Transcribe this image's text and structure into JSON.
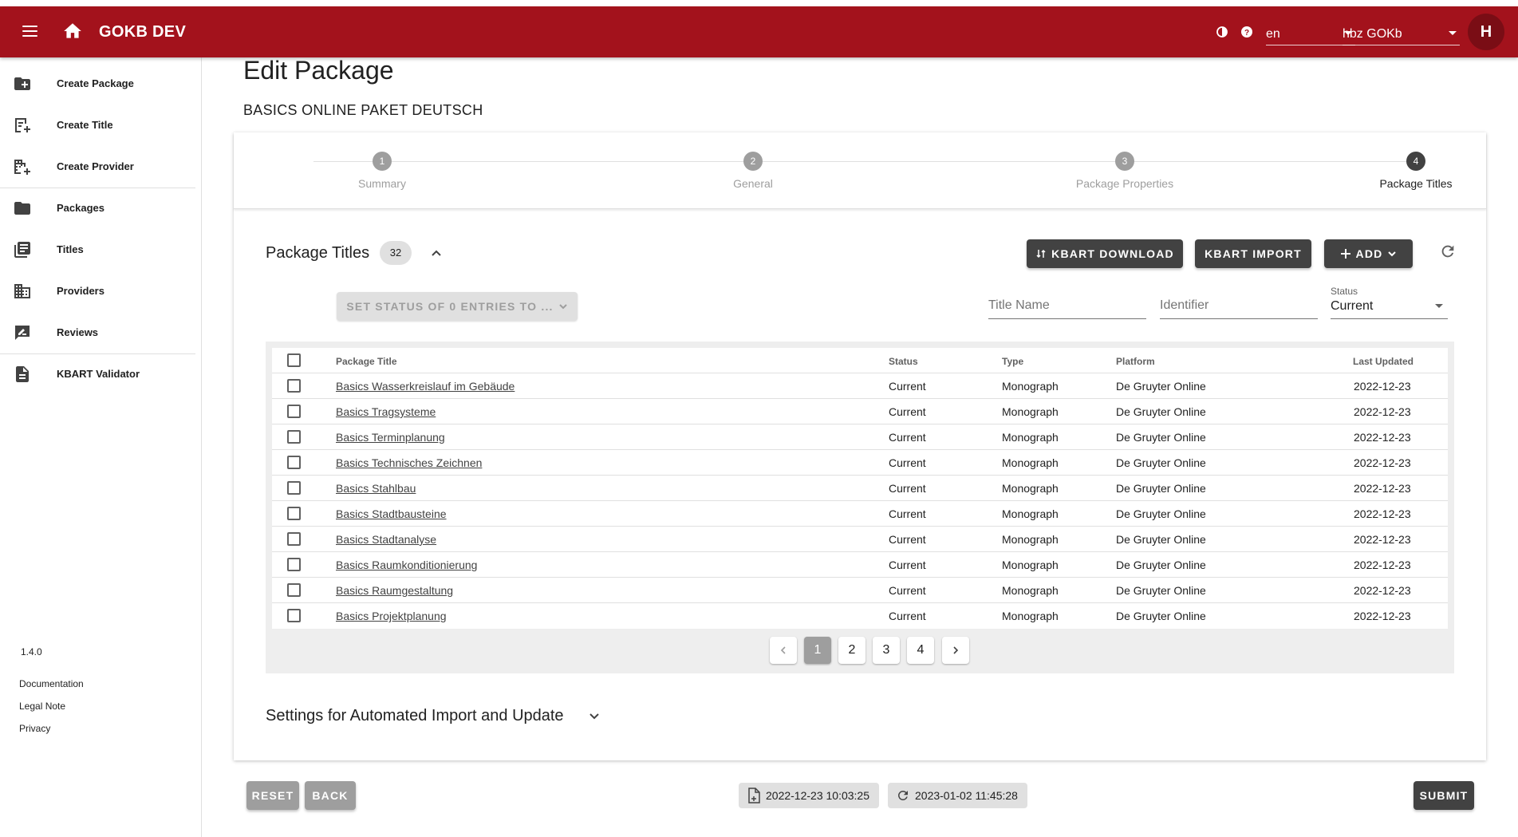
{
  "header": {
    "app_title": "GOKB DEV",
    "language": "en",
    "namespace": "hbz GOKb",
    "avatar_initial": "H",
    "brand_color": "#a3121c"
  },
  "sidebar": {
    "items": [
      {
        "label": "Create Package",
        "icon": "create-package-icon"
      },
      {
        "label": "Create Title",
        "icon": "create-title-icon"
      },
      {
        "label": "Create Provider",
        "icon": "create-provider-icon"
      },
      {
        "label": "Packages",
        "icon": "folder-icon"
      },
      {
        "label": "Titles",
        "icon": "list-icon"
      },
      {
        "label": "Providers",
        "icon": "domain-icon"
      },
      {
        "label": "Reviews",
        "icon": "review-icon"
      },
      {
        "label": "KBART Validator",
        "icon": "document-icon"
      }
    ],
    "version": "1.4.0",
    "footer_links": [
      "Documentation",
      "Legal Note",
      "Privacy"
    ]
  },
  "page": {
    "title": "Edit Package",
    "package_name": "BASICS ONLINE PAKET DEUTSCH"
  },
  "stepper": {
    "steps": [
      {
        "num": "1",
        "label": "Summary"
      },
      {
        "num": "2",
        "label": "General"
      },
      {
        "num": "3",
        "label": "Package Properties"
      },
      {
        "num": "4",
        "label": "Package Titles"
      }
    ],
    "active_step": 4
  },
  "titles_section": {
    "title": "Package Titles",
    "count": "32",
    "kbart_download_label": "KBART DOWNLOAD",
    "kbart_import_label": "KBART IMPORT",
    "add_label": "ADD",
    "bulk_status_label": "SET STATUS OF 0 ENTRIES TO ...",
    "filter_title_placeholder": "Title Name",
    "filter_identifier_placeholder": "Identifier",
    "status_filter_label": "Status",
    "status_filter_value": "Current"
  },
  "table": {
    "columns": [
      "Package Title",
      "Status",
      "Type",
      "Platform",
      "Last Updated"
    ],
    "rows": [
      {
        "title": "Basics Wasserkreislauf im Gebäude",
        "status": "Current",
        "type": "Monograph",
        "platform": "De Gruyter Online",
        "updated": "2022-12-23"
      },
      {
        "title": "Basics Tragsysteme",
        "status": "Current",
        "type": "Monograph",
        "platform": "De Gruyter Online",
        "updated": "2022-12-23"
      },
      {
        "title": "Basics Terminplanung",
        "status": "Current",
        "type": "Monograph",
        "platform": "De Gruyter Online",
        "updated": "2022-12-23"
      },
      {
        "title": "Basics Technisches Zeichnen",
        "status": "Current",
        "type": "Monograph",
        "platform": "De Gruyter Online",
        "updated": "2022-12-23"
      },
      {
        "title": "Basics Stahlbau",
        "status": "Current",
        "type": "Monograph",
        "platform": "De Gruyter Online",
        "updated": "2022-12-23"
      },
      {
        "title": "Basics Stadtbausteine",
        "status": "Current",
        "type": "Monograph",
        "platform": "De Gruyter Online",
        "updated": "2022-12-23"
      },
      {
        "title": "Basics Stadtanalyse",
        "status": "Current",
        "type": "Monograph",
        "platform": "De Gruyter Online",
        "updated": "2022-12-23"
      },
      {
        "title": "Basics Raumkonditionierung",
        "status": "Current",
        "type": "Monograph",
        "platform": "De Gruyter Online",
        "updated": "2022-12-23"
      },
      {
        "title": "Basics Raumgestaltung",
        "status": "Current",
        "type": "Monograph",
        "platform": "De Gruyter Online",
        "updated": "2022-12-23"
      },
      {
        "title": "Basics Projektplanung",
        "status": "Current",
        "type": "Monograph",
        "platform": "De Gruyter Online",
        "updated": "2022-12-23"
      }
    ]
  },
  "pagination": {
    "pages": [
      "1",
      "2",
      "3",
      "4"
    ],
    "current_page": "1"
  },
  "settings_section": {
    "title": "Settings for Automated Import and Update"
  },
  "footer": {
    "reset_label": "RESET",
    "back_label": "BACK",
    "created": "2022-12-23 10:03:25",
    "updated": "2023-01-02 11:45:28",
    "submit_label": "SUBMIT"
  }
}
